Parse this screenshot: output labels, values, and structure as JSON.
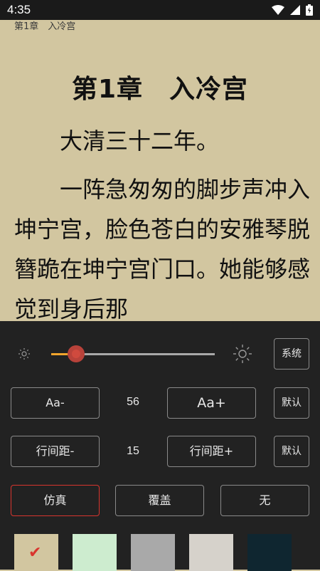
{
  "status_bar": {
    "time": "4:35"
  },
  "reader": {
    "header_chapter": "第1章　入冷宫",
    "chapter_title": "第1章　入冷宫",
    "paragraphs": [
      "　　大清三十二年。",
      "　　一阵急匆匆的脚步声冲入坤宁宫，脸色苍白的安雅琴脱簪跪在坤宁宫门口。她能够感觉到身后那"
    ]
  },
  "settings": {
    "brightness": {
      "level": 0.15,
      "system_label": "系统"
    },
    "font_size": {
      "decrease_label": "Aa-",
      "value": "56",
      "increase_label": "Aa+",
      "default_label": "默认"
    },
    "line_spacing": {
      "decrease_label": "行间距-",
      "value": "15",
      "increase_label": "行间距+",
      "default_label": "默认"
    },
    "page_turn": {
      "options": [
        "仿真",
        "覆盖",
        "无"
      ],
      "selected": "仿真"
    },
    "themes": {
      "colors": [
        "#d2c6a0",
        "#cdeccf",
        "#a9a9a9",
        "#d6d2cb",
        "#0f2630"
      ],
      "selected_index": 0
    }
  },
  "colors": {
    "accent": "#d9352e",
    "slider_fill": "#f2a52c",
    "panel_bg": "#222222",
    "page_bg": "#d2c6a0"
  }
}
